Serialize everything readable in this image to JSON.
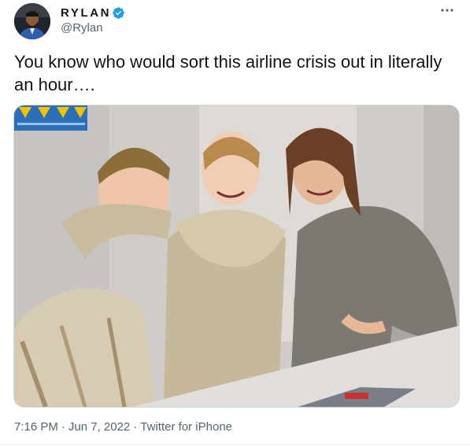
{
  "author": {
    "display_name": "RYLAN",
    "handle": "@Rylan",
    "verified": true,
    "avatar_icon": "profile-photo"
  },
  "more_icon": "ellipsis-icon",
  "tweet": {
    "text": "You know who would sort this airline crisis out in literally an hour….",
    "media_icon": "photo-three-people-at-airline-desk"
  },
  "meta": {
    "time": "7:16 PM",
    "date": "Jun 7, 2022",
    "client": "Twitter for iPhone",
    "separator": "·"
  },
  "colors": {
    "verified_blue": "#1d9bf0",
    "secondary_text": "#536471",
    "primary_text": "#0f1419",
    "border": "#cfd9de"
  }
}
